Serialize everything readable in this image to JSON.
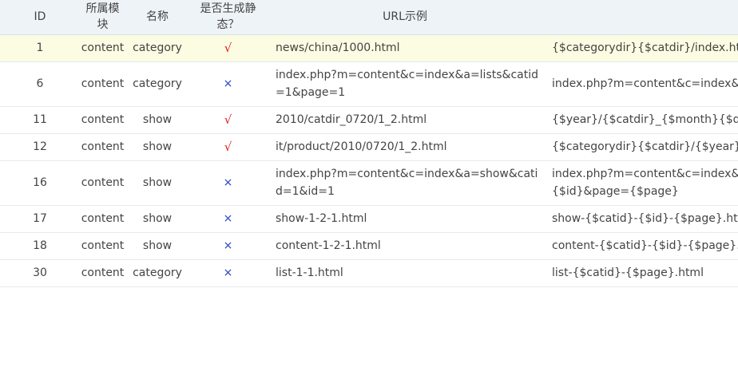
{
  "columns": {
    "id": "ID",
    "module": "所属模块",
    "name": "名称",
    "static": "是否生成静态？",
    "example": "URL示例"
  },
  "marks": {
    "yes": "√",
    "no": "×"
  },
  "colors": {
    "yes": "#e02020",
    "no": "#2240c8",
    "header_bg": "#eef3f7",
    "highlight_bg": "#fbfce2"
  },
  "rows": [
    {
      "id": "1",
      "module": "content",
      "name": "category",
      "static": "√",
      "example": "news/china/1000.html",
      "rule": "{$categorydir}{$catdir}/index.html|"
    },
    {
      "id": "6",
      "module": "content",
      "name": "category",
      "static": "×",
      "example": "index.php?m=content&c=index&a=lists&catid=1&page=1",
      "rule": "index.php?m=content&c=index&a="
    },
    {
      "id": "11",
      "module": "content",
      "name": "show",
      "static": "√",
      "example": "2010/catdir_0720/1_2.html",
      "rule": "{$year}/{$catdir}_{$month}{$day}/"
    },
    {
      "id": "12",
      "module": "content",
      "name": "show",
      "static": "√",
      "example": "it/product/2010/0720/1_2.html",
      "rule": "{$categorydir}{$catdir}/{$year}/{$m"
    },
    {
      "id": "16",
      "module": "content",
      "name": "show",
      "static": "×",
      "example": "index.php?m=content&c=index&a=show&catid=1&id=1",
      "rule": "index.php?m=content&c=index&a=",
      "rule_line2": "{$id}&page={$page}"
    },
    {
      "id": "17",
      "module": "content",
      "name": "show",
      "static": "×",
      "example": "show-1-2-1.html",
      "rule": "show-{$catid}-{$id}-{$page}.html"
    },
    {
      "id": "18",
      "module": "content",
      "name": "show",
      "static": "×",
      "example": "content-1-2-1.html",
      "rule": "content-{$catid}-{$id}-{$page}.htm"
    },
    {
      "id": "30",
      "module": "content",
      "name": "category",
      "static": "×",
      "example": "list-1-1.html",
      "rule": "list-{$catid}-{$page}.html"
    }
  ]
}
